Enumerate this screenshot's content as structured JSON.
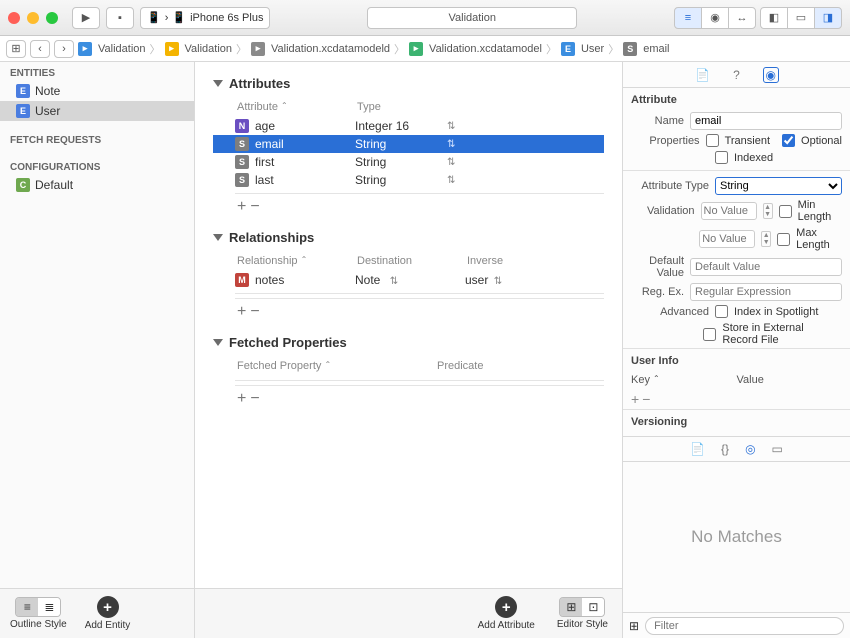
{
  "toolbar": {
    "scheme_app": "A",
    "scheme_device": "iPhone 6s Plus",
    "title": "Validation"
  },
  "breadcrumb": [
    {
      "icon": "ci-blue",
      "label": "Validation"
    },
    {
      "icon": "ci-yellow",
      "label": "Validation"
    },
    {
      "icon": "ci-gray",
      "label": "Validation.xcdatamodeld"
    },
    {
      "icon": "ci-green",
      "label": "Validation.xcdatamodel"
    },
    {
      "icon": "ci-e",
      "label": "User"
    },
    {
      "icon": "ci-s",
      "label": "email"
    }
  ],
  "sidebar": {
    "entities_header": "ENTITIES",
    "entities": [
      {
        "label": "Note"
      },
      {
        "label": "User"
      }
    ],
    "fetch_header": "FETCH REQUESTS",
    "config_header": "CONFIGURATIONS",
    "configs": [
      {
        "label": "Default"
      }
    ]
  },
  "bottom": {
    "outline_style": "Outline Style",
    "add_entity": "Add Entity",
    "add_attribute": "Add Attribute",
    "editor_style": "Editor Style"
  },
  "center": {
    "attributes": {
      "title": "Attributes",
      "col_attr": "Attribute",
      "col_type": "Type",
      "rows": [
        {
          "chip": "N",
          "name": "age",
          "type": "Integer 16"
        },
        {
          "chip": "S",
          "name": "email",
          "type": "String"
        },
        {
          "chip": "S",
          "name": "first",
          "type": "String"
        },
        {
          "chip": "S",
          "name": "last",
          "type": "String"
        }
      ]
    },
    "relationships": {
      "title": "Relationships",
      "col_rel": "Relationship",
      "col_dest": "Destination",
      "col_inv": "Inverse",
      "rows": [
        {
          "chip": "M",
          "name": "notes",
          "dest": "Note",
          "inv": "user"
        }
      ]
    },
    "fetched": {
      "title": "Fetched Properties",
      "col_fp": "Fetched Property",
      "col_pred": "Predicate"
    }
  },
  "inspector": {
    "attribute_header": "Attribute",
    "name_label": "Name",
    "name_value": "email",
    "props_label": "Properties",
    "transient": "Transient",
    "optional": "Optional",
    "indexed": "Indexed",
    "attr_type_label": "Attribute Type",
    "attr_type_value": "String",
    "validation_label": "Validation",
    "no_value": "No Value",
    "min_len": "Min Length",
    "max_len": "Max Length",
    "default_label": "Default Value",
    "default_ph": "Default Value",
    "regex_label": "Reg. Ex.",
    "regex_ph": "Regular Expression",
    "advanced_label": "Advanced",
    "spotlight": "Index in Spotlight",
    "external": "Store in External Record File",
    "userinfo": "User Info",
    "key": "Key",
    "value": "Value",
    "versioning": "Versioning",
    "no_matches": "No Matches",
    "filter_ph": "Filter"
  }
}
